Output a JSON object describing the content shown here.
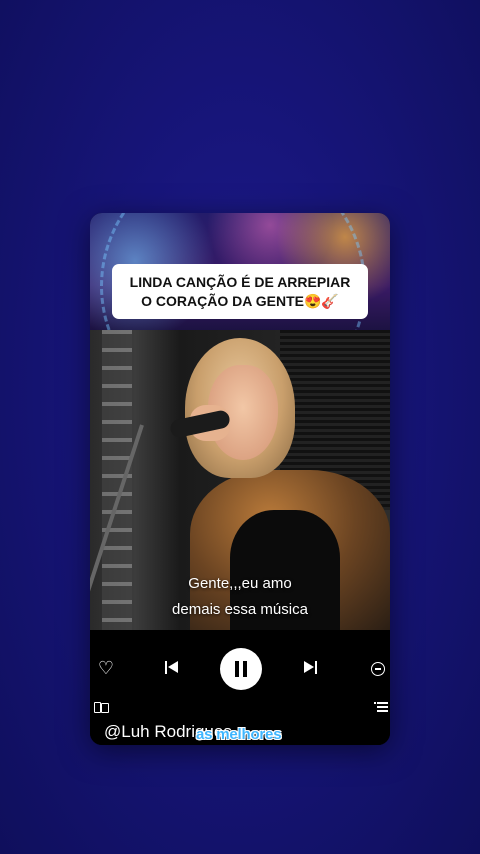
{
  "banner": {
    "line1": "LINDA CANÇÃO É DE ARREPIAR",
    "line2": "O CORAÇÃO DA GENTE😍🎸"
  },
  "watermark": "",
  "lyrics": {
    "line1": "Gente,,,eu amo",
    "line2": "demais essa música"
  },
  "player": {
    "heart_icon": "heart-outline-icon",
    "prev_icon": "skip-previous-icon",
    "play_state": "pause-icon",
    "next_icon": "skip-next-icon",
    "remove_icon": "minus-circle-icon",
    "device_icon": "connect-device-icon",
    "queue_icon": "queue-icon"
  },
  "handle": "@Luh Rodrigues",
  "caption": "as melhores",
  "colors": {
    "background": "#17157a",
    "caption": "#3fb6ff",
    "banner_bg": "#ffffff"
  }
}
